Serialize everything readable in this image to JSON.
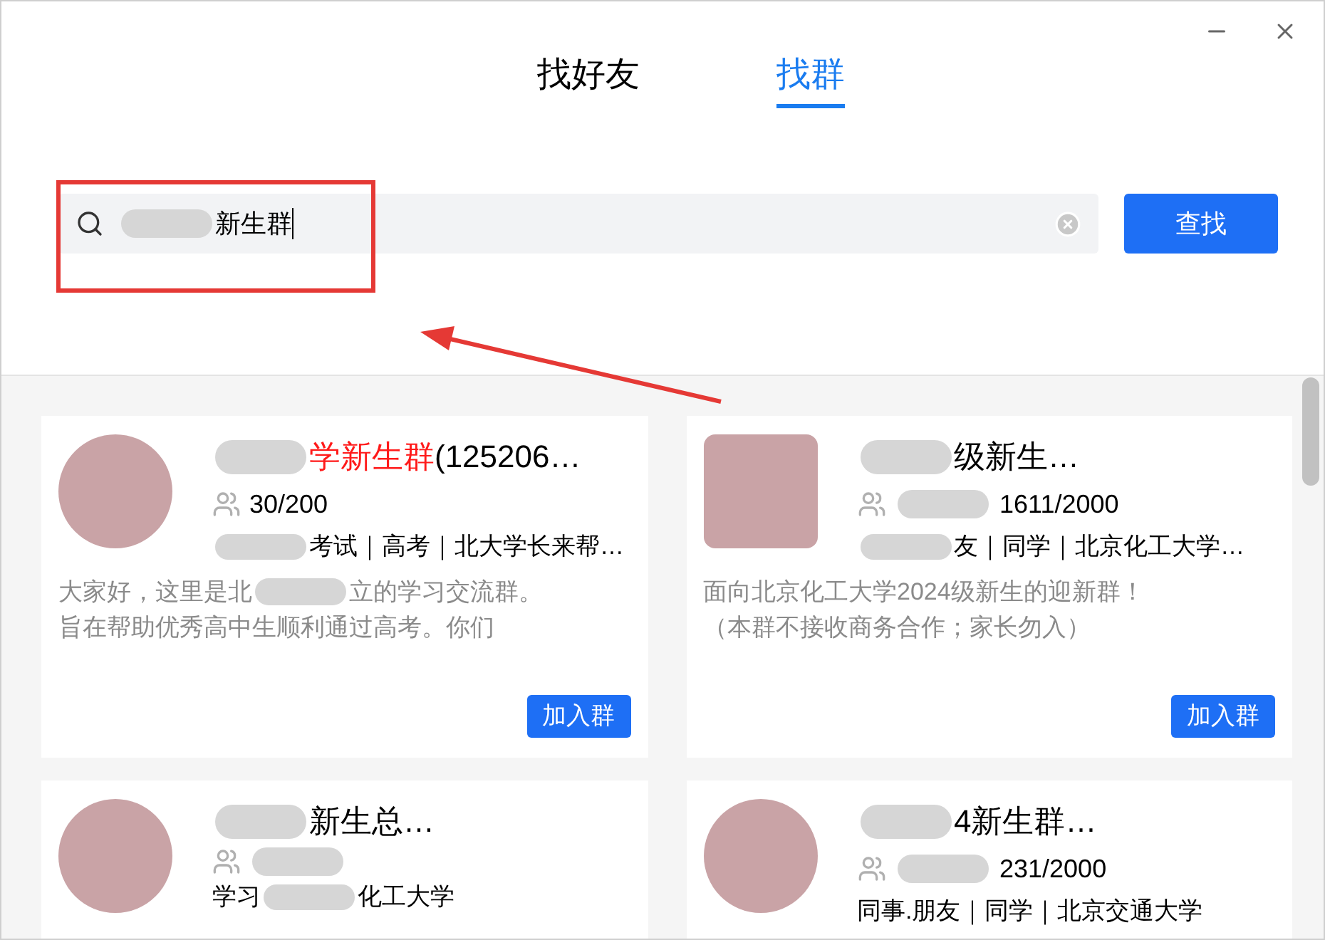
{
  "tabs": [
    {
      "label": "找好友",
      "selected": false
    },
    {
      "label": "找群",
      "selected": true
    }
  ],
  "search": {
    "value": [
      {
        "kind": "redacted"
      },
      {
        "kind": "text",
        "text": "新生群"
      }
    ]
  },
  "search_button": "查找",
  "groups": [
    {
      "kind": "round",
      "title": [
        {
          "kind": "redacted"
        },
        {
          "kind": "text",
          "text": "学新生群",
          "highlight": true
        },
        {
          "kind": "text",
          "text": "(125206…",
          "highlight": false
        }
      ],
      "members": [
        {
          "kind": "text",
          "text": "30/200"
        }
      ],
      "tags": [
        {
          "kind": "redacted"
        },
        {
          "kind": "text",
          "text": "考试｜高考｜北大学长来帮…"
        }
      ],
      "description": [
        [
          {
            "kind": "text",
            "text": "大家好，这里是北"
          },
          {
            "kind": "redacted"
          },
          {
            "kind": "text",
            "text": "立的学习交流群。"
          }
        ],
        [
          {
            "kind": "text",
            "text": "旨在帮助优秀高中生顺利通过高考。你们"
          }
        ]
      ],
      "join": "加入群"
    },
    {
      "kind": "square",
      "title": [
        {
          "kind": "redacted"
        },
        {
          "kind": "text",
          "text": "级新生…",
          "highlight": false
        }
      ],
      "members": [
        {
          "kind": "redacted"
        },
        {
          "kind": "text",
          "text": "1611/2000"
        }
      ],
      "tags": [
        {
          "kind": "redacted"
        },
        {
          "kind": "text",
          "text": "友｜同学｜北京化工大学…"
        }
      ],
      "description": [
        [
          {
            "kind": "text",
            "text": "面向北京化工大学2024级新生的迎新群！"
          }
        ],
        [
          {
            "kind": "text",
            "text": "（本群不接收商务合作；家长勿入）"
          }
        ]
      ],
      "join": "加入群"
    },
    {
      "kind": "round",
      "title": [
        {
          "kind": "redacted"
        },
        {
          "kind": "text",
          "text": "新生总…",
          "highlight": false
        }
      ],
      "members": [
        {
          "kind": "redacted"
        }
      ],
      "tags": [
        {
          "kind": "text",
          "text": "学习"
        },
        {
          "kind": "redacted"
        },
        {
          "kind": "text",
          "text": "化工大学"
        }
      ]
    },
    {
      "kind": "round",
      "title": [
        {
          "kind": "redacted"
        },
        {
          "kind": "text",
          "text": "4新生群…",
          "highlight": false
        }
      ],
      "members": [
        {
          "kind": "redacted"
        },
        {
          "kind": "text",
          "text": "231/2000"
        }
      ],
      "tags": [
        {
          "kind": "text",
          "text": "同事.朋友｜同学｜北京交通大学"
        }
      ]
    }
  ]
}
